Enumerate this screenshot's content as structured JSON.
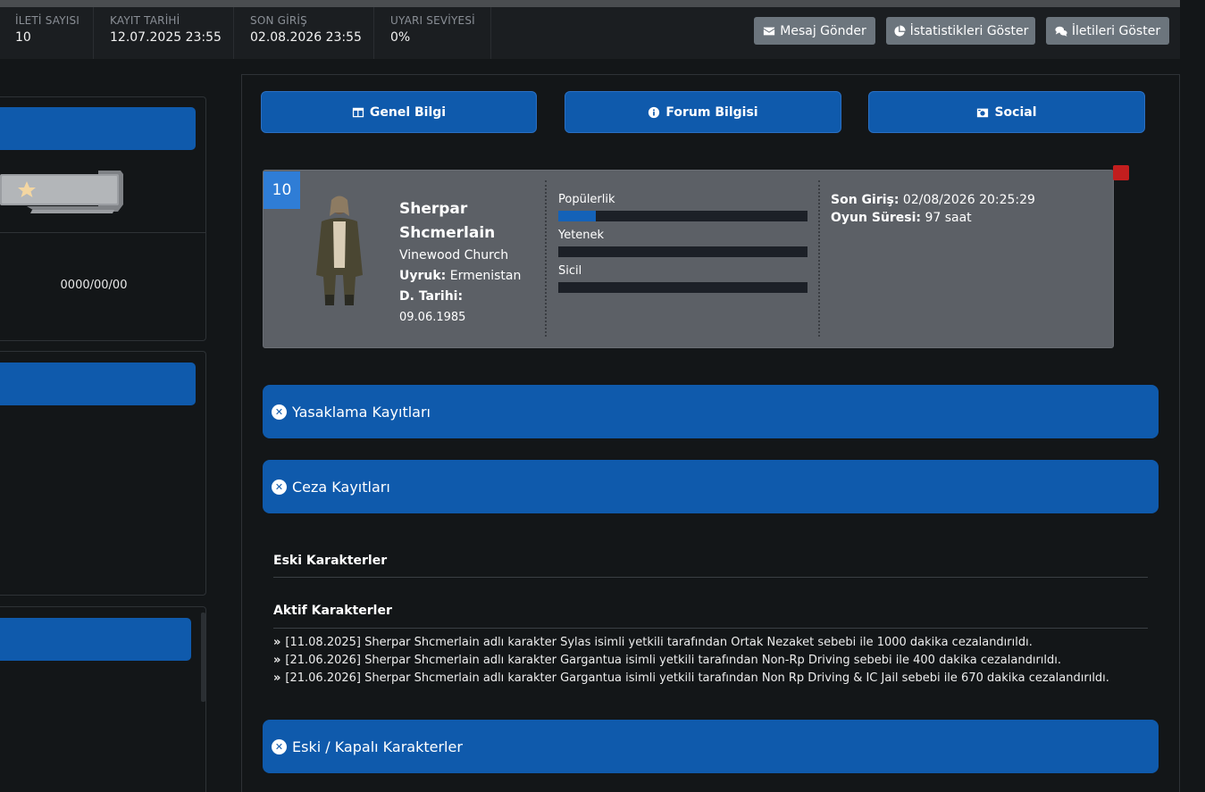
{
  "stats": [
    {
      "label": "İLETİ SAYISI",
      "value": "10"
    },
    {
      "label": "KAYIT TARİHİ",
      "value": "12.07.2025 23:55"
    },
    {
      "label": "SON GİRİŞ",
      "value": "02.08.2026 23:55"
    },
    {
      "label": "UYARI SEVİYESİ",
      "value": "0%"
    }
  ],
  "actions": {
    "message": "Mesaj Gönder",
    "stats": "İstatistikleri Göster",
    "posts": "İletileri Göster"
  },
  "sidebar": {
    "date": "0000/00/00"
  },
  "tabs": {
    "general": "Genel Bilgi",
    "forum": "Forum Bilgisi",
    "social": "Social"
  },
  "character": {
    "level": "10",
    "name_line1": "Sherpar",
    "name_line2": "Shcmerlain",
    "location": "Vinewood Church",
    "nationality_label": "Uyruk:",
    "nationality": "Ermenistan",
    "birth_label": "D. Tarihi:",
    "birth": "09.06.1985",
    "bars": [
      {
        "label": "Popülerlik",
        "fill": 0.15
      },
      {
        "label": "Yetenek",
        "fill": 0
      },
      {
        "label": "Sicil",
        "fill": 0
      }
    ],
    "last_login_label": "Son Giriş:",
    "last_login": "02/08/2026 20:25:29",
    "playtime_label": "Oyun Süresi:",
    "playtime": "97 saat"
  },
  "accordions": {
    "bans": "Yasaklama Kayıtları",
    "penalties": "Ceza Kayıtları",
    "old_chars": "Eski / Kapalı Karakterler"
  },
  "sections": {
    "old": "Eski Karakterler",
    "active": "Aktif Karakterler"
  },
  "logs": [
    "[11.08.2025] Sherpar Shcmerlain adlı karakter Sylas isimli yetkili tarafından Ortak Nezaket sebebi ile 1000 dakika cezalandırıldı.",
    "[21.06.2026] Sherpar Shcmerlain adlı karakter Gargantua isimli yetkili tarafından Non-Rp Driving sebebi ile 400 dakika cezalandırıldı.",
    "[21.06.2026] Sherpar Shcmerlain adlı karakter Gargantua isimli yetkili tarafından Non Rp Driving & IC Jail sebebi ile 670 dakika cezalandırıldı."
  ],
  "colors": {
    "accent": "#0f5aac",
    "background": "#131618",
    "card": "#5c6066",
    "alert": "#c21e1e"
  }
}
